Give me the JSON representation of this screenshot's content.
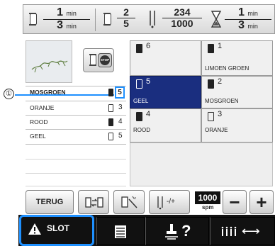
{
  "status": {
    "time": {
      "num": "1",
      "num_unit": "min",
      "den": "3",
      "den_unit": "min"
    },
    "color_count": {
      "num": "2",
      "den": "5"
    },
    "stitch_count": {
      "num": "234",
      "den": "1000"
    },
    "remaining_time": {
      "num": "1",
      "num_unit": "min",
      "den": "3",
      "den_unit": "min"
    }
  },
  "left_list": [
    {
      "name": "MOSGROEN",
      "number": "5",
      "spool": "filled"
    },
    {
      "name": "ORANJE",
      "number": "3",
      "spool": "outline"
    },
    {
      "name": "ROOD",
      "number": "4",
      "spool": "filled"
    },
    {
      "name": "GEEL",
      "number": "5",
      "spool": "outline"
    }
  ],
  "callout": {
    "marker": "①"
  },
  "grid": [
    {
      "number": "6",
      "name": "",
      "spool": "filled",
      "selected": false
    },
    {
      "number": "1",
      "name": "LIMOEN GROEN",
      "spool": "filled",
      "selected": false
    },
    {
      "number": "5",
      "name": "GEEL",
      "spool": "outline",
      "selected": true
    },
    {
      "number": "2",
      "name": "MOSGROEN",
      "spool": "filled",
      "selected": false
    },
    {
      "number": "4",
      "name": "ROOD",
      "spool": "filled",
      "selected": false
    },
    {
      "number": "3",
      "name": "ORANJE",
      "spool": "outline",
      "selected": false
    }
  ],
  "buttons": {
    "back": "TERUG",
    "stitch_step": "-/+",
    "speed_value": "1000",
    "speed_unit": "spm",
    "minus": "−",
    "plus": "+",
    "stop_icon_text": "STOP"
  },
  "tabs": {
    "slot": "SLOT",
    "help": "?",
    "thread_arrow": "⟷"
  },
  "colors": {
    "accent_blue": "#1a2e7f",
    "highlight_blue": "#1e90ff"
  }
}
